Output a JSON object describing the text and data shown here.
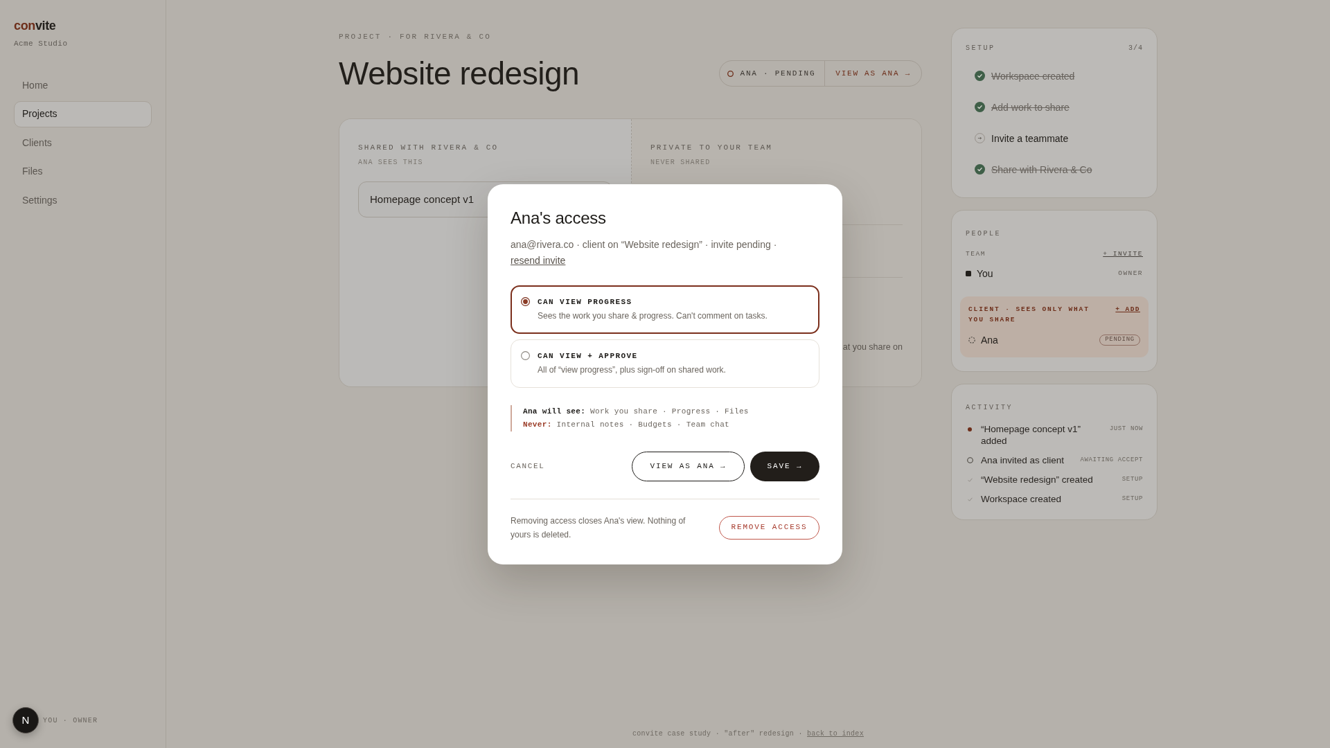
{
  "sidebar": {
    "logo": {
      "accent": "con",
      "rest": "vite"
    },
    "workspace": "Acme Studio",
    "nav": [
      {
        "label": "Home",
        "selected": false
      },
      {
        "label": "Projects",
        "selected": true
      },
      {
        "label": "Clients",
        "selected": false
      },
      {
        "label": "Files",
        "selected": false
      },
      {
        "label": "Settings",
        "selected": false
      }
    ],
    "user": {
      "initial": "N",
      "label": "YOU · OWNER"
    }
  },
  "header": {
    "eyebrow": "PROJECT · FOR RIVERA & CO",
    "title": "Website redesign",
    "status": "ANA · PENDING",
    "action": "VIEW AS ANA →"
  },
  "board": {
    "shared": {
      "title": "SHARED WITH RIVERA & CO",
      "subtitle": "ANA SEES THIS",
      "items": [
        "Homepage concept v1"
      ]
    },
    "private": {
      "title": "PRIVATE TO YOUR TEAM",
      "subtitle": "NEVER SHARED",
      "fragment": "at you share on"
    }
  },
  "modal": {
    "title": "Ana's access",
    "description": "ana@rivera.co · client on “Website redesign” · invite pending ·",
    "link": "resend invite",
    "options": [
      {
        "label": "CAN VIEW PROGRESS",
        "description": "Sees the work you share & progress. Can't comment on tasks.",
        "selected": true
      },
      {
        "label": "CAN VIEW + APPROVE",
        "description": "All of “view progress”, plus sign-off on shared work.",
        "selected": false
      }
    ],
    "visibility": [
      {
        "kind": "allowed",
        "label": "Ana will see:",
        "items": "Work you share · Progress · Files"
      },
      {
        "kind": "blocked",
        "label": "Never:",
        "items": "Internal notes · Budgets · Team chat"
      }
    ],
    "cancel": "CANCEL",
    "secondary": "VIEW AS ANA →",
    "primary": "SAVE →",
    "note": "Removing access closes Ana's view. Nothing of yours is deleted.",
    "danger": "REMOVE ACCESS"
  },
  "setup": {
    "title": "SETUP",
    "count": "3/4",
    "steps": [
      {
        "label": "Workspace created",
        "done": true
      },
      {
        "label": "Add work to share",
        "done": true
      },
      {
        "label": "Invite a teammate",
        "done": false
      },
      {
        "label": "Share with Rivera & Co",
        "done": true
      }
    ]
  },
  "people": {
    "title": "PEOPLE",
    "team": {
      "heading": "TEAM",
      "action": "+ INVITE",
      "members": [
        {
          "name": "You",
          "role": "OWNER"
        }
      ]
    },
    "client": {
      "heading": "CLIENT · SEES ONLY WHAT YOU SHARE",
      "action": "+ ADD",
      "members": [
        {
          "name": "Ana",
          "status": "PENDING"
        }
      ]
    }
  },
  "activity": {
    "title": "ACTIVITY",
    "items": [
      {
        "kind": "new",
        "text": "“Homepage concept v1” added",
        "time": "JUST NOW"
      },
      {
        "kind": "pending",
        "text": "Ana invited as client",
        "time": "AWAITING ACCEPT"
      },
      {
        "kind": "done",
        "text": "“Website redesign” created",
        "time": "SETUP"
      },
      {
        "kind": "done",
        "text": "Workspace created",
        "time": "SETUP"
      }
    ]
  },
  "footer": {
    "text": "convite case study · \"after\" redesign ·",
    "link": "back to index"
  }
}
